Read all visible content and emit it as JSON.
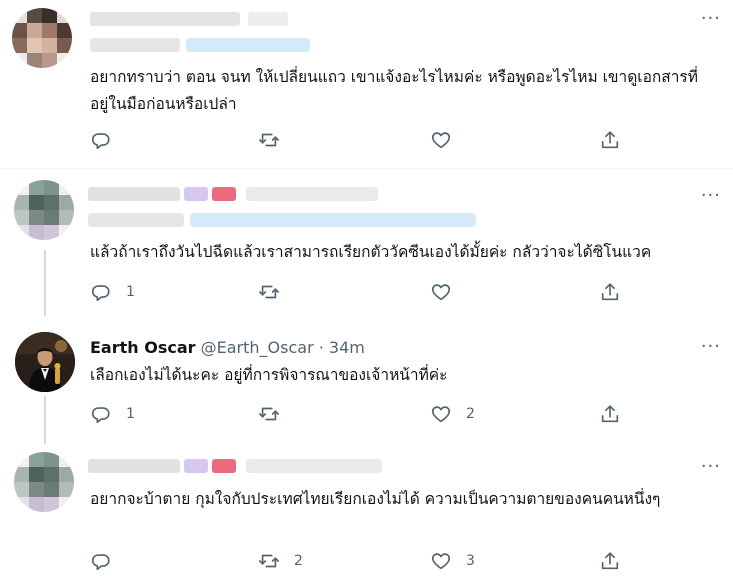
{
  "tweets": [
    {
      "text": "อยากทราบว่า ตอน จนท ให้เปลี่ยนแถว เขาแจ้งอะไรไหมค่ะ หรือพูดอะไรไหม เขาดูเอกสารที่อยู่ในมือก่อนหรือเปล่า",
      "reply_count": "",
      "retweet_count": "",
      "like_count": ""
    },
    {
      "text": "แล้วถ้าเราถึงวันไปฉีดแล้วเราสามารถเรียกตัววัคซีนเองได้มั้ยค่ะ กลัวว่าจะได้ซิโนแวค",
      "reply_count": "1",
      "retweet_count": "",
      "like_count": ""
    },
    {
      "display_name": "Earth Oscar",
      "handle": "@Earth_Oscar",
      "separator": "·",
      "time": "34m",
      "text": "เลือกเองไม่ได้นะคะ อยู่ที่การพิจารณาของเจ้าหน้าที่ค่ะ",
      "reply_count": "1",
      "retweet_count": "",
      "like_count": "2"
    },
    {
      "text": "อยากจะบ้าตาย กุมใจกับประเทศไทยเรียกเองไม่ได้ ความเป็นความตายของคนคนหนึ่งๆ",
      "reply_count": "",
      "retweet_count": "2",
      "like_count": "3"
    }
  ],
  "more_glyph": "···",
  "icons": [
    "reply-icon",
    "retweet-icon",
    "like-icon",
    "share-icon",
    "more-icon"
  ],
  "colors": {
    "text": "#0f1419",
    "secondary": "#536471",
    "divider": "#eff3f4",
    "thread_line": "#cfd9de"
  }
}
